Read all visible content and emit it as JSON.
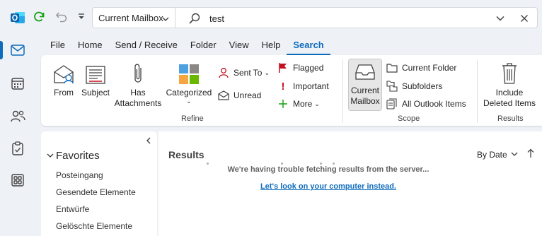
{
  "titlebar": {
    "mailbox_scope": "Current Mailbox",
    "search_value": "test"
  },
  "tabs": [
    {
      "label": "File"
    },
    {
      "label": "Home"
    },
    {
      "label": "Send / Receive"
    },
    {
      "label": "Folder"
    },
    {
      "label": "View"
    },
    {
      "label": "Help"
    },
    {
      "label": "Search",
      "active": true
    }
  ],
  "ribbon": {
    "refine": {
      "group_label": "Refine",
      "from": "From",
      "subject": "Subject",
      "has_attachments_1": "Has",
      "has_attachments_2": "Attachments",
      "categorized": "Categorized",
      "sent_to": "Sent To",
      "unread": "Unread",
      "flagged": "Flagged",
      "important": "Important",
      "more": "More"
    },
    "scope": {
      "group_label": "Scope",
      "current_mailbox_1": "Current",
      "current_mailbox_2": "Mailbox",
      "current_folder": "Current Folder",
      "subfolders": "Subfolders",
      "all_outlook_items": "All Outlook Items"
    },
    "results": {
      "group_label": "Results",
      "include_deleted_1": "Include",
      "include_deleted_2": "Deleted Items"
    }
  },
  "navpane": {
    "favorites_label": "Favorites",
    "items": [
      "Posteingang",
      "Gesendete Elemente",
      "Entwürfe",
      "Gelöschte Elemente"
    ]
  },
  "results_pane": {
    "title": "Results",
    "sort_label": "By Date",
    "error_message": "We're having trouble fetching results from the server...",
    "fallback_link": "Let's look on your computer instead."
  },
  "colors": {
    "accent": "#0f6cbd",
    "background": "#eef1f6"
  }
}
